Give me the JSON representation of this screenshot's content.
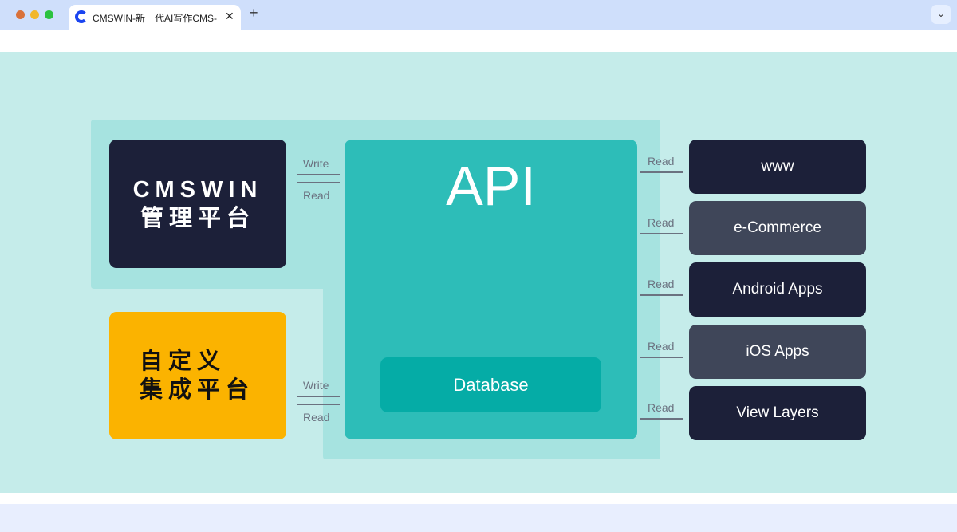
{
  "browser": {
    "tab_title": "CMSWIN-新一代AI写作CMS-",
    "close": "✕",
    "new_tab": "+",
    "dropdown": "⌄"
  },
  "colors": {
    "canvas": "#c5ecea",
    "api": "#2dbdb8",
    "database": "#05aca6",
    "dark": "#1c2039",
    "gray": "#3f4659",
    "yellow": "#fbb300"
  },
  "diagram": {
    "cms_line1": "CMSWIN",
    "cms_line2": "管理平台",
    "custom_line1": "自定义",
    "custom_line2": "集成平台",
    "api": "API",
    "database": "Database",
    "write": "Write",
    "read": "Read",
    "outputs": [
      "www",
      "e-Commerce",
      "Android Apps",
      "iOS Apps",
      "View Layers"
    ]
  }
}
